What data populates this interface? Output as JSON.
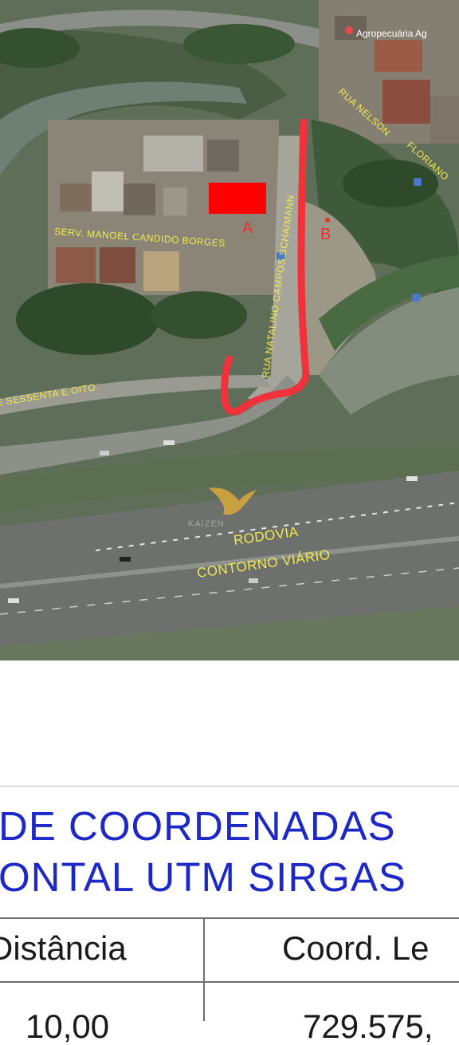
{
  "map": {
    "poi_label": "Agropecuária Ag",
    "street_labels": {
      "rua_nelson": "RUA NELSON",
      "floriano": "FLORIANO",
      "serv_manoel": "SERV. MANOEL CANDIDO BORGES",
      "rua_natalino": "RUA NATALINO CAMPOS SCHAIMANN",
      "sessenta_e_oito": "E SESSENTA E OITO",
      "rodovia_line1": "RODOVIA",
      "rodovia_line2": "CONTORNO VIÁRIO"
    },
    "point_a": "A",
    "point_b": "B",
    "watermark": "KAIZEN",
    "colors": {
      "route": "#f2323a",
      "parcel": "#ff0000",
      "label": "#f2ea4a",
      "point_text": "#e8322e"
    }
  },
  "document": {
    "heading_line1": "DE COORDENADAS",
    "heading_line2": "ONTAL UTM SIRGAS",
    "heading_color": "#1d28c8",
    "table": {
      "headers": [
        "Distância",
        "Coord. Le"
      ],
      "rows": [
        [
          "10,00",
          "729.575,"
        ]
      ]
    }
  }
}
